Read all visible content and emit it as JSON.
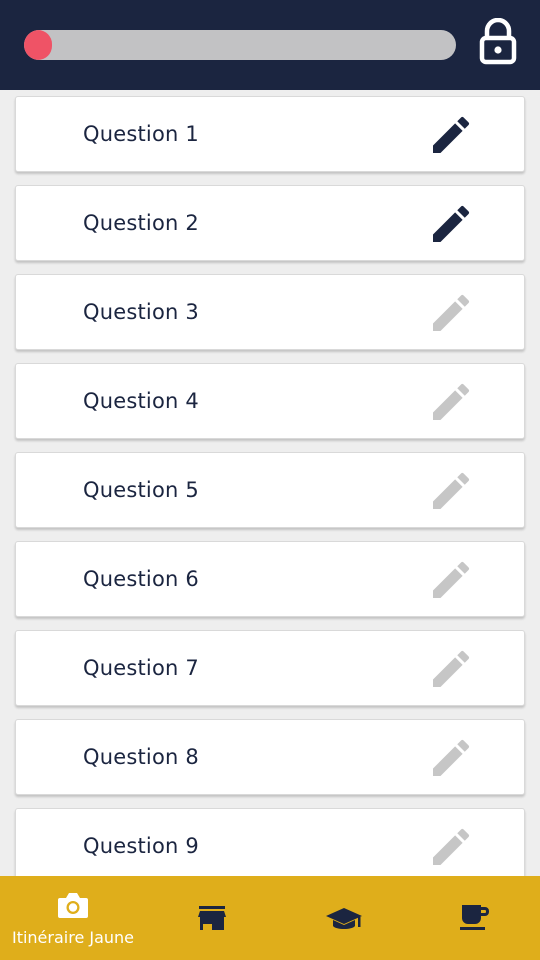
{
  "header": {
    "progress_percent": 5,
    "progress_color": "#ef5366",
    "track_color": "#c2c2c4",
    "background": "#1b2540",
    "lock_icon": "lock-icon"
  },
  "questions": [
    {
      "label": "Question 1",
      "state": "active"
    },
    {
      "label": "Question 2",
      "state": "active"
    },
    {
      "label": "Question 3",
      "state": "disabled"
    },
    {
      "label": "Question 4",
      "state": "disabled"
    },
    {
      "label": "Question 5",
      "state": "disabled"
    },
    {
      "label": "Question 6",
      "state": "disabled"
    },
    {
      "label": "Question 7",
      "state": "disabled"
    },
    {
      "label": "Question 8",
      "state": "disabled"
    },
    {
      "label": "Question 9",
      "state": "disabled"
    }
  ],
  "colors": {
    "active_icon": "#1b2540",
    "disabled_icon": "#c6c6c6",
    "nav_background": "#dfae1b",
    "nav_icon": "#1b2540",
    "nav_active": "#ffffff"
  },
  "bottom_nav": {
    "items": [
      {
        "icon": "camera-icon",
        "label": "Itinéraire Jaune",
        "active": true
      },
      {
        "icon": "store-icon",
        "label": "",
        "active": false
      },
      {
        "icon": "graduation-cap-icon",
        "label": "",
        "active": false
      },
      {
        "icon": "coffee-cup-icon",
        "label": "",
        "active": false
      }
    ]
  }
}
